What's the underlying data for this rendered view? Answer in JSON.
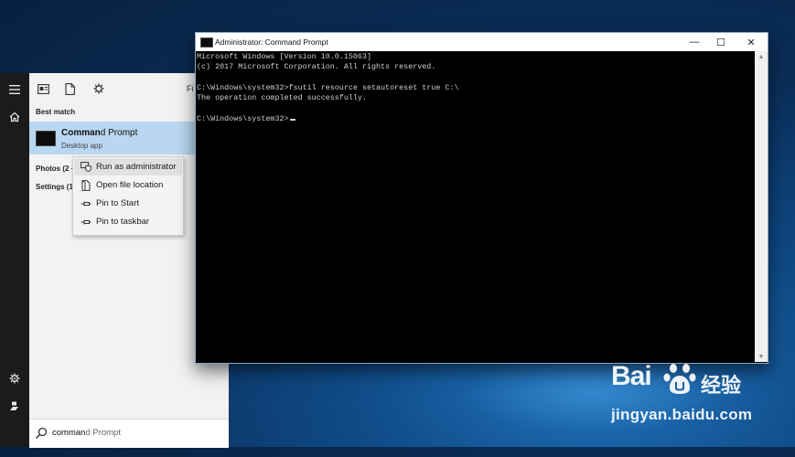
{
  "start_menu": {
    "rail_icons": [
      "hamburger-menu-icon",
      "home-icon",
      "gear-icon",
      "user-icon"
    ],
    "toolbar": {
      "icons": [
        "all-apps-icon",
        "documents-icon",
        "settings-icon"
      ],
      "truncated_label": "Fi"
    },
    "best_match_heading": "Best match",
    "best_match": {
      "title_bold": "Comman",
      "title_rest": "d Prompt",
      "subtitle": "Desktop app"
    },
    "categories": [
      "Photos (2 +",
      "Settings (1"
    ],
    "context_menu": [
      {
        "label": "Run as administrator",
        "icon": "shield-icon",
        "highlighted": true
      },
      {
        "label": "Open file location",
        "icon": "folder-icon",
        "highlighted": false
      },
      {
        "label": "Pin to Start",
        "icon": "pin-icon",
        "highlighted": false
      },
      {
        "label": "Pin to taskbar",
        "icon": "pin-icon",
        "highlighted": false
      }
    ],
    "search": {
      "typed": "comman",
      "suggestion": "d Prompt"
    }
  },
  "console": {
    "title": "Administrator: Command Prompt",
    "controls": {
      "minimize": "—",
      "maximize": "☐",
      "close": "✕"
    },
    "lines": [
      "Microsoft Windows [Version 10.0.15063]",
      "(c) 2017 Microsoft Corporation. All rights reserved.",
      "",
      "C:\\Windows\\system32>fsutil resource setautoreset true C:\\",
      "The operation completed successfully.",
      "",
      "C:\\Windows\\system32>"
    ]
  },
  "watermark": {
    "brand": "Bai",
    "brand_suffix": "经验",
    "url": "jingyan.baidu.com"
  },
  "colors": {
    "desktop_bg": "#0a2d58",
    "start_rail": "#1b1b1b",
    "start_panel": "#f2f2f2",
    "selection": "#b9d7f1",
    "console_bg": "#000000",
    "console_text": "#cfcfcf"
  }
}
